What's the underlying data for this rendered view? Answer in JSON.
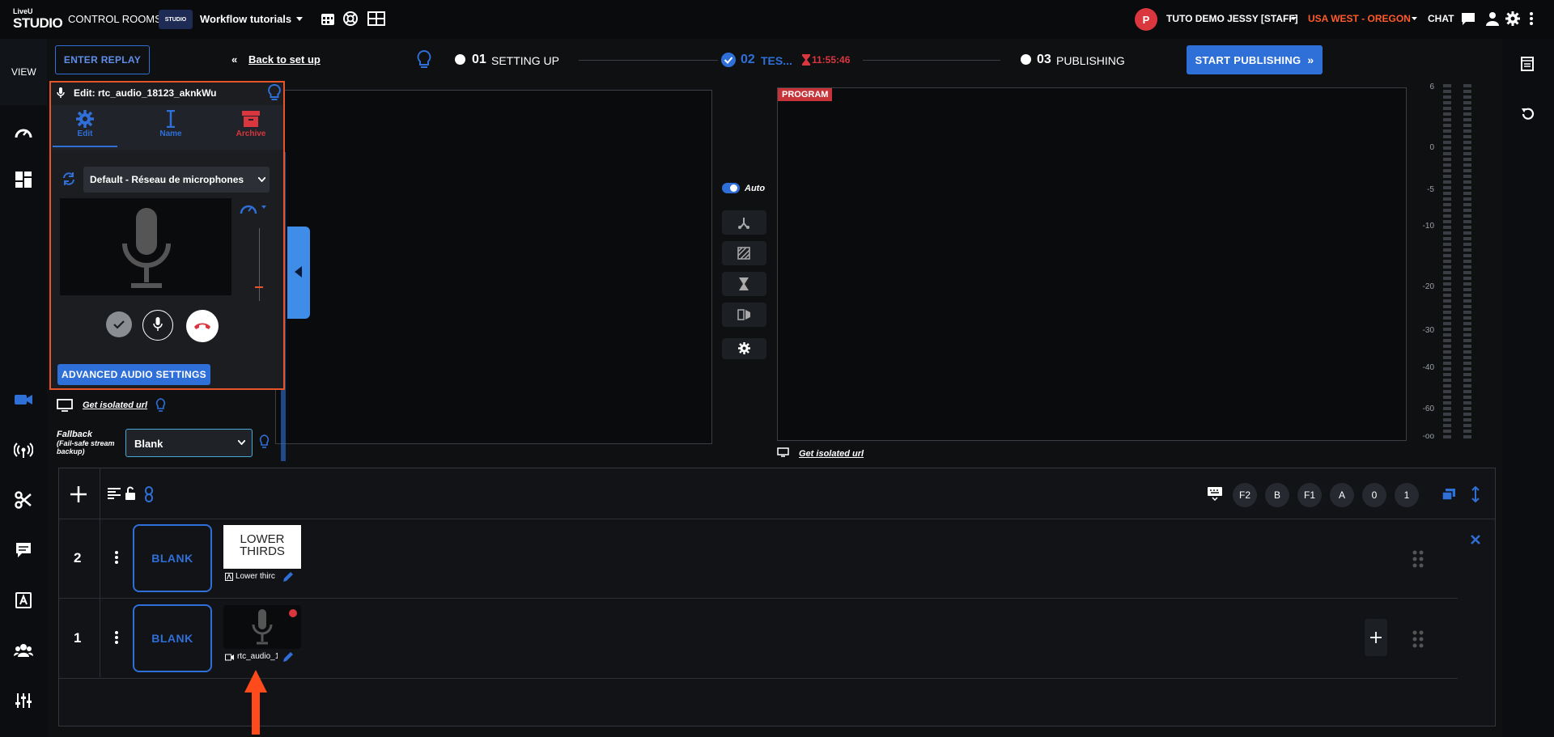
{
  "topbar": {
    "logo_top": "LiveU",
    "logo_bottom": "STUDIO",
    "control_rooms": "CONTROL ROOMS",
    "project_logo": "STUDIO",
    "project": "Workflow tutorials",
    "user_initial": "P",
    "user": "TUTO DEMO JESSY [STAFF]",
    "region": "USA WEST - OREGON",
    "chat": "CHAT"
  },
  "leftrail": {
    "view": "VIEW"
  },
  "header": {
    "enter_replay": "ENTER REPLAY",
    "back": "Back to set up",
    "steps": [
      {
        "num": "01",
        "label": "SETTING UP"
      },
      {
        "num": "02",
        "label": "TES..."
      },
      {
        "num": "03",
        "label": "PUBLISHING"
      }
    ],
    "timer": "11:55:46",
    "start_publishing": "START PUBLISHING"
  },
  "editpanel": {
    "title": "Edit: rtc_audio_18123_aknkWu",
    "tabs": [
      {
        "label": "Edit"
      },
      {
        "label": "Name"
      },
      {
        "label": "Archive"
      }
    ],
    "device": "Default - Réseau de microphones",
    "advanced": "ADVANCED AUDIO SETTINGS"
  },
  "below_panel": {
    "isolated_url": "Get isolated url",
    "fallback_label": "Fallback",
    "fallback_sub": "(Fail-safe stream backup)",
    "fallback_value": "Blank"
  },
  "program": {
    "badge": "PROGRAM",
    "isolated_url": "Get isolated url",
    "auto": "Auto"
  },
  "vu_scale": [
    "6",
    "0",
    "-5",
    "-10",
    "-20",
    "-30",
    "-40",
    "-60",
    "-oo"
  ],
  "layers": {
    "keys": [
      "F2",
      "B",
      "F1",
      "A",
      "0",
      "1"
    ],
    "rows": [
      {
        "num": "2",
        "blank": "BLANK",
        "thumb": "LOWER THIRDS",
        "caption": "Lower thirc"
      },
      {
        "num": "1",
        "blank": "BLANK",
        "thumb": "",
        "caption": "rtc_audio_1"
      }
    ]
  },
  "colors": {
    "accent": "#2f6fd8",
    "alert": "#e8542a",
    "live_red": "#d9363e",
    "region": "#ff5a2c"
  }
}
